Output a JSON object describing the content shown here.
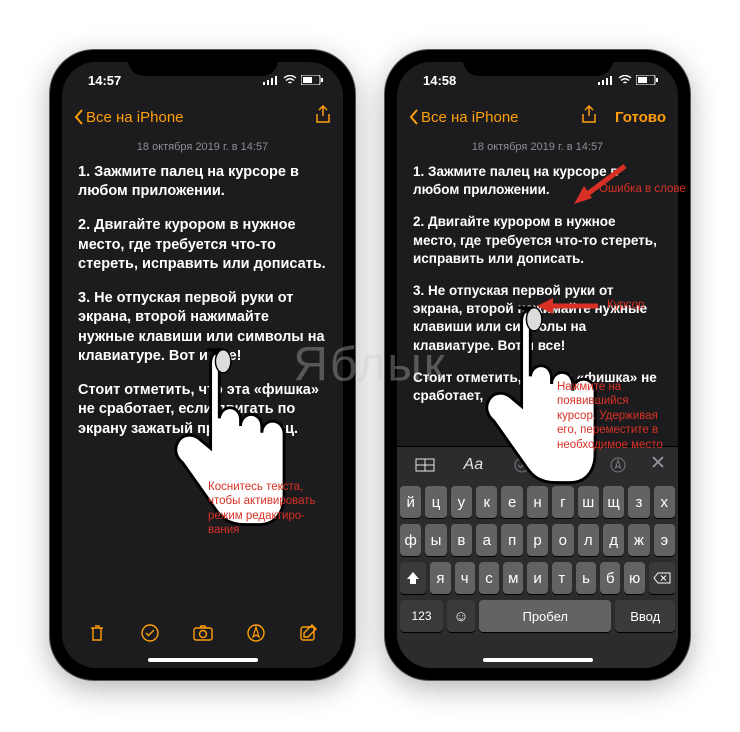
{
  "watermark": "Яблык",
  "phone_left": {
    "time": "14:57",
    "back_label": "Все на iPhone",
    "date": "18 октября 2019 г. в 14:57",
    "p1": "1. Зажмите палец на курсоре в любом приложении.",
    "p2": "2. Двигайте курором в нужное место, где требуется что-то стереть, исправить или дописать.",
    "p3": "3. Не отпуская первой руки от экрана, второй нажимайте нужные клавиши или символы на клавиатуре. Вот и все!",
    "p4": "Стоит отметить, что эта «фишка» не сработает, если двигать по экрану зажатый просто палец.",
    "annotation": "Коснитесь текста,\nчтобы активировать\nрежим редактиро-\nвания",
    "toolbar_icons": [
      "trash",
      "check",
      "camera",
      "pen",
      "compose"
    ]
  },
  "phone_right": {
    "time": "14:58",
    "back_label": "Все на iPhone",
    "done_label": "Готово",
    "date": "18 октября 2019 г. в 14:57",
    "p1": "1. Зажмите палец на курсоре в любом приложении.",
    "p2": "2. Двигайте курором в нужное место, где требуется что-то стереть, исправить или дописать.",
    "p3": "3. Не отпуская первой руки от экрана, второй нажимайте нужные клавиши или символы на клавиатуре. Вот и все!",
    "p4": "Стоит отметить, что эта «фишка» не сработает,",
    "ann_typo": "Ошибка в слове",
    "ann_cursor": "Курсор",
    "ann_hold": "Нажмите на\nпоявившийся\nкурсор. Удерживая\nего, переместите в\nнеобходимое место",
    "keyboard": {
      "row1": [
        "й",
        "ц",
        "у",
        "к",
        "е",
        "н",
        "г",
        "ш",
        "щ",
        "з",
        "х"
      ],
      "row2": [
        "ф",
        "ы",
        "в",
        "а",
        "п",
        "р",
        "о",
        "л",
        "д",
        "ж",
        "э"
      ],
      "row3_keys": [
        "я",
        "ч",
        "с",
        "м",
        "и",
        "т",
        "ь",
        "б",
        "ю"
      ],
      "num": "123",
      "space": "Пробел",
      "enter": "Ввод"
    }
  }
}
